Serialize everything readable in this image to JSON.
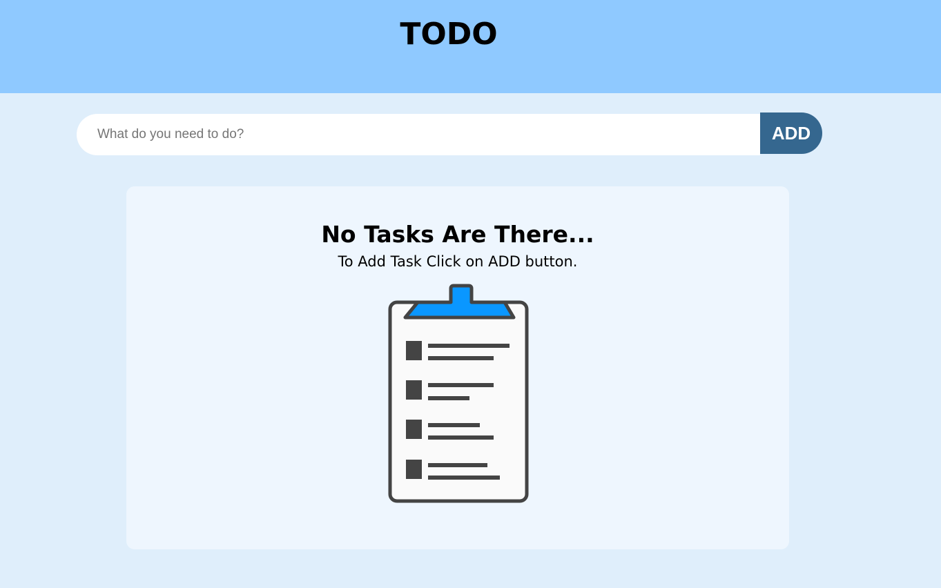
{
  "app": {
    "title": "TODO"
  },
  "task_form": {
    "input_value": "",
    "input_placeholder": "What do you need to do?",
    "add_label": "ADD"
  },
  "empty_state": {
    "heading": "No Tasks Are There...",
    "subtext": "To Add Task Click on ADD button.",
    "illustration_icon": "clipboard-checklist-icon"
  },
  "colors": {
    "header_bg": "#8fc9ff",
    "page_bg": "#dfeefb",
    "add_button_bg": "#35678f",
    "card_bg": "#eef6fe",
    "clipboard_clip": "#0a97ff"
  }
}
